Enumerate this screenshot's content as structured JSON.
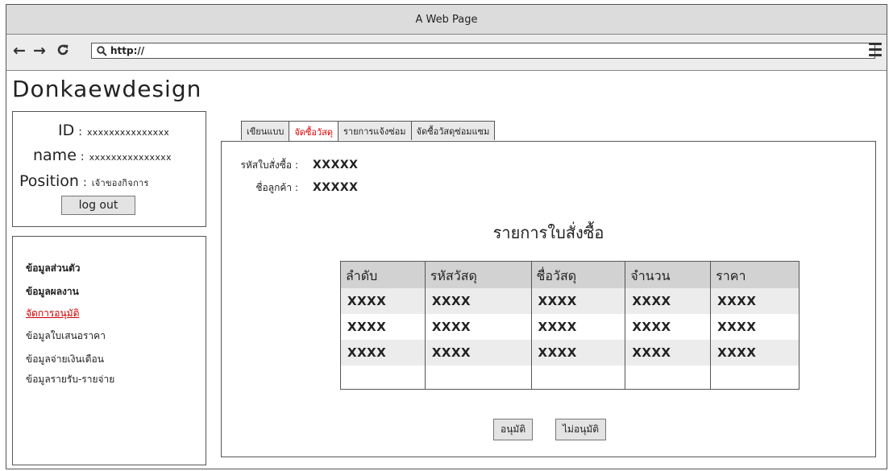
{
  "window": {
    "title": "A Web Page"
  },
  "browser": {
    "url": "http://",
    "back_icon": "back-arrow-icon",
    "forward_icon": "forward-arrow-icon",
    "reload_icon": "reload-icon",
    "menu_icon": "hamburger-menu-icon"
  },
  "site": {
    "title": "Donkaewdesign"
  },
  "user": {
    "id_label": "ID",
    "id_value": "xxxxxxxxxxxxxxx",
    "name_label": "name",
    "name_value": "xxxxxxxxxxxxxxx",
    "position_label": "Position",
    "position_value": "เจ้าของกิจการ",
    "colon": ":",
    "logout_label": "log out"
  },
  "sidebar": {
    "items": [
      {
        "label": "ข้อมูลส่วนตัว"
      },
      {
        "label": "ข้อมูลผลงาน"
      },
      {
        "label": "จัดการอนุมัติ"
      },
      {
        "label": "ข้อมูลใบเสนอราคา"
      },
      {
        "label": "ข้อมูลจ่ายเงินเดือน"
      },
      {
        "label": "ข้อมูลรายรับ-รายจ่าย"
      }
    ]
  },
  "tabs": [
    {
      "label": "เขียนแบบ"
    },
    {
      "label": "จัดซื้อวัสดุ"
    },
    {
      "label": "รายการแจ้งซ่อม"
    },
    {
      "label": "จัดซื้อวัสดุซ่อมแซม"
    }
  ],
  "order": {
    "code_label": "รหัสใบสั่งซื้อ :",
    "code_value": "XXXXX",
    "customer_label": "ชื่อลูกค้า :",
    "customer_value": "XXXXX",
    "list_title": "รายการใบสั่งซื้อ"
  },
  "table": {
    "headers": [
      "ลำดับ",
      "รหัสวัสดุ",
      "ชื่อวัสดุ",
      "จำนวน",
      "ราคา"
    ],
    "rows": [
      [
        "XXXX",
        "XXXX",
        "XXXX",
        "XXXX",
        "XXXX"
      ],
      [
        "XXXX",
        "XXXX",
        "XXXX",
        "XXXX",
        "XXXX"
      ],
      [
        "XXXX",
        "XXXX",
        "XXXX",
        "XXXX",
        "XXXX"
      ]
    ]
  },
  "actions": {
    "approve_label": "อนุมัติ",
    "reject_label": "ไม่อนุมัติ"
  }
}
